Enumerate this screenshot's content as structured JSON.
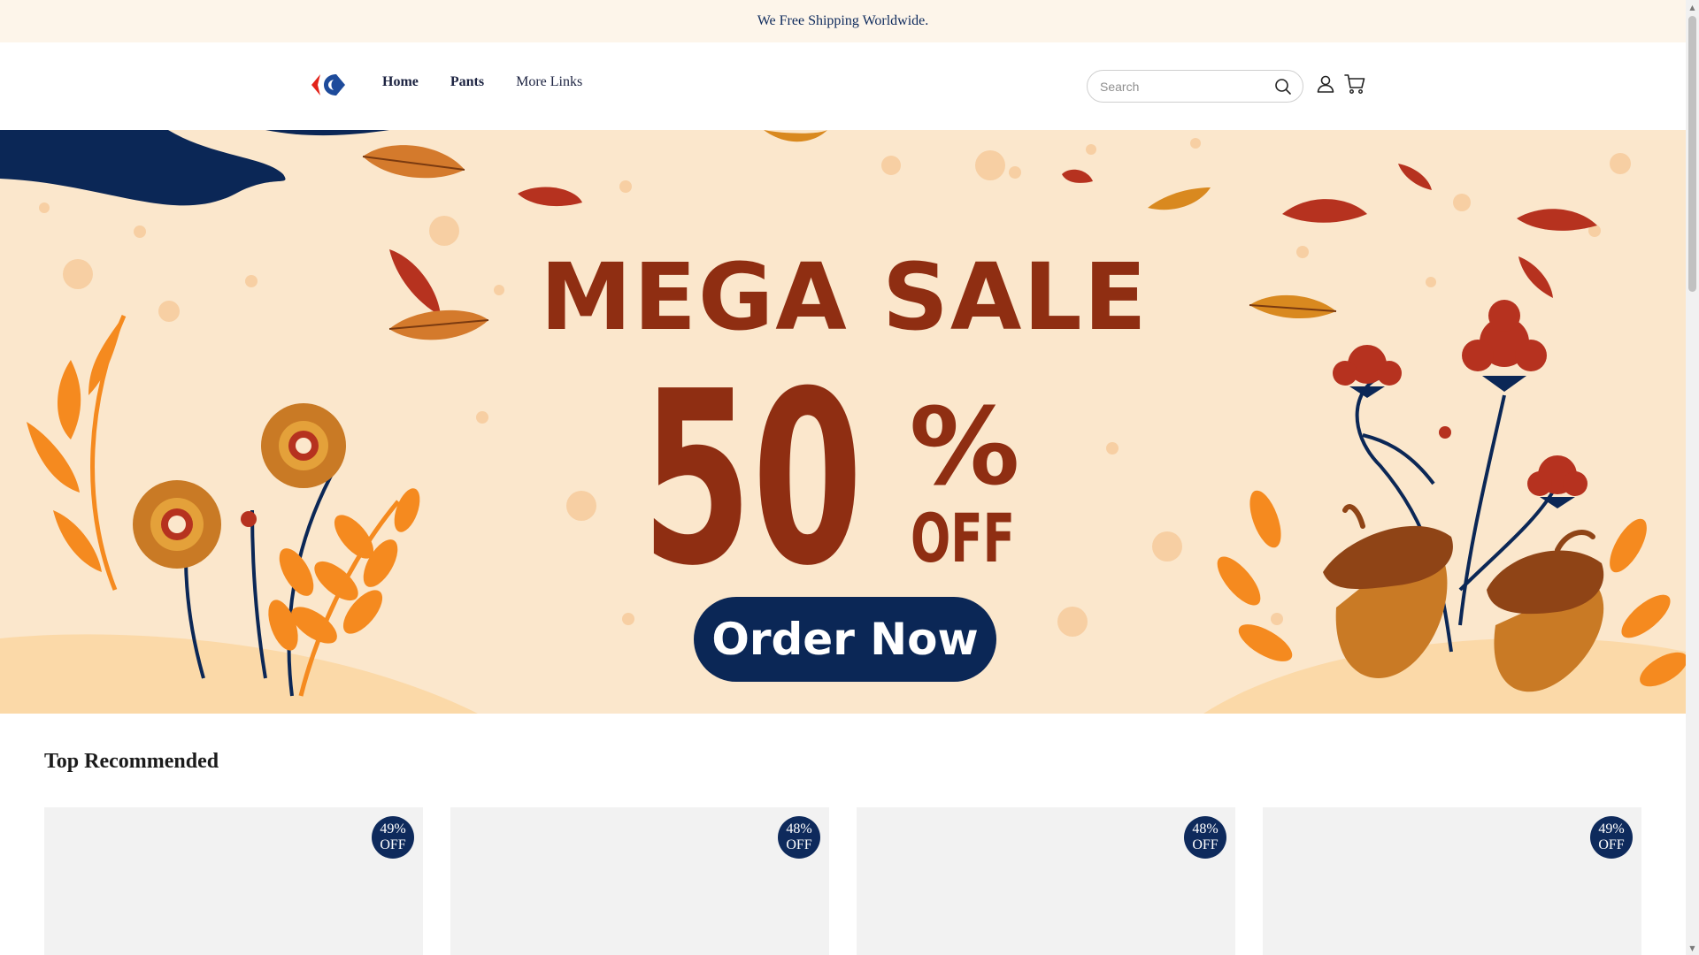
{
  "announcement": {
    "text": "We Free Shipping Worldwide."
  },
  "header": {
    "logo_icon": "carrefour-logo",
    "nav": [
      {
        "label": "Home"
      },
      {
        "label": "Pants"
      },
      {
        "label": "More Links"
      }
    ],
    "search": {
      "placeholder": "Search",
      "value": ""
    },
    "icons": [
      "search-icon",
      "account-icon",
      "cart-icon"
    ]
  },
  "hero": {
    "headline": "MEGA SALE",
    "big_number": "50",
    "percent": "%",
    "off": "OFF",
    "cta": "Order Now",
    "colors": {
      "background": "#fbe7cc",
      "headline": "#8f2e12",
      "cta_bg": "#0b2756",
      "cta_text": "#ffffff",
      "accent_orange": "#f58a1f",
      "navy": "#0b2756"
    }
  },
  "recommended": {
    "title": "Top Recommended",
    "products": [
      {
        "badge_percent": "49%",
        "badge_off": "OFF"
      },
      {
        "badge_percent": "48%",
        "badge_off": "OFF"
      },
      {
        "badge_percent": "48%",
        "badge_off": "OFF"
      },
      {
        "badge_percent": "49%",
        "badge_off": "OFF"
      }
    ]
  }
}
